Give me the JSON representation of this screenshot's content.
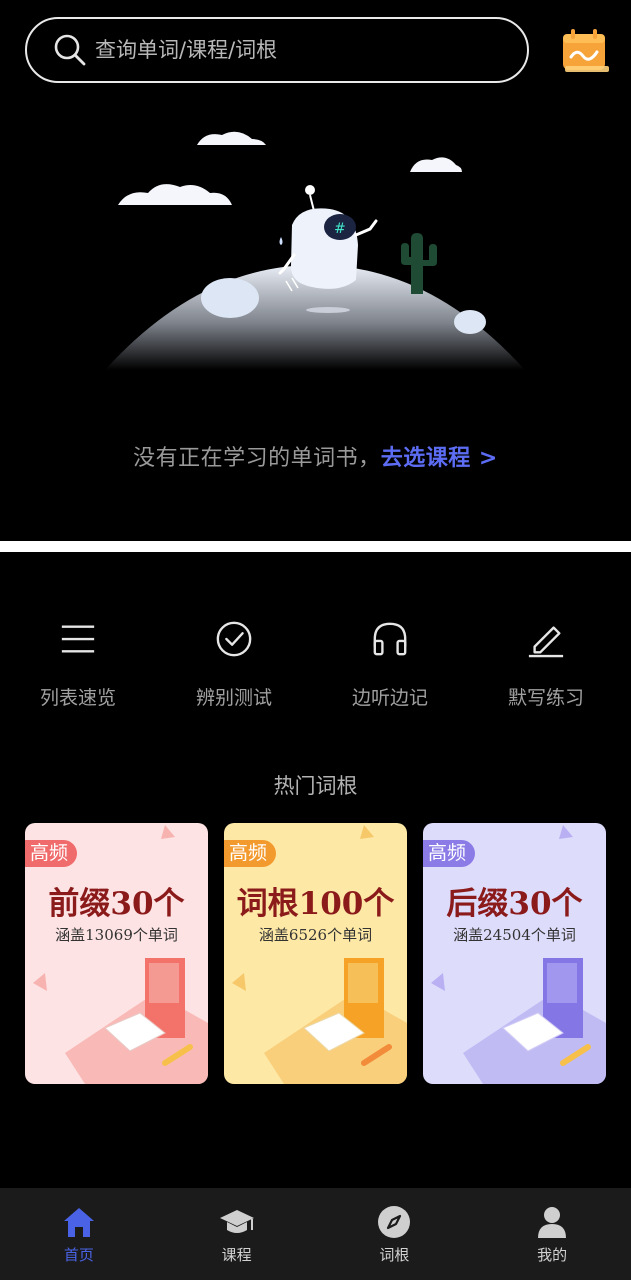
{
  "search": {
    "placeholder": "查询单词/课程/词根"
  },
  "hero": {
    "empty_message": "没有正在学习的单词书，",
    "link_text": "去选课程",
    "link_chevron": ">"
  },
  "actions": [
    {
      "label": "列表速览",
      "icon": "list-icon"
    },
    {
      "label": "辨别测试",
      "icon": "check-circle-icon"
    },
    {
      "label": "边听边记",
      "icon": "headphones-icon"
    },
    {
      "label": "默写练习",
      "icon": "pencil-icon"
    }
  ],
  "hot_roots": {
    "title": "热门词根",
    "cards": [
      {
        "badge": "高频",
        "title": "前缀30个",
        "subtitle": "涵盖13069个单词",
        "bg": "#fde3e4",
        "badge_color": "#f06b6b",
        "book_color": "#f3726a"
      },
      {
        "badge": "高频",
        "title": "词根100个",
        "subtitle": "涵盖6526个单词",
        "bg": "#fde8a6",
        "badge_color": "#f39a2e",
        "book_color": "#f5a227"
      },
      {
        "badge": "高频",
        "title": "后缀30个",
        "subtitle": "涵盖24504个单词",
        "bg": "#dedcfb",
        "badge_color": "#8a7be6",
        "book_color": "#8576e6"
      }
    ]
  },
  "tabbar": {
    "items": [
      {
        "label": "首页",
        "icon": "home-icon",
        "active": true
      },
      {
        "label": "课程",
        "icon": "graduation-cap-icon",
        "active": false
      },
      {
        "label": "词根",
        "icon": "compass-icon",
        "active": false
      },
      {
        "label": "我的",
        "icon": "user-icon",
        "active": false
      }
    ],
    "active_color": "#4a63e6"
  }
}
